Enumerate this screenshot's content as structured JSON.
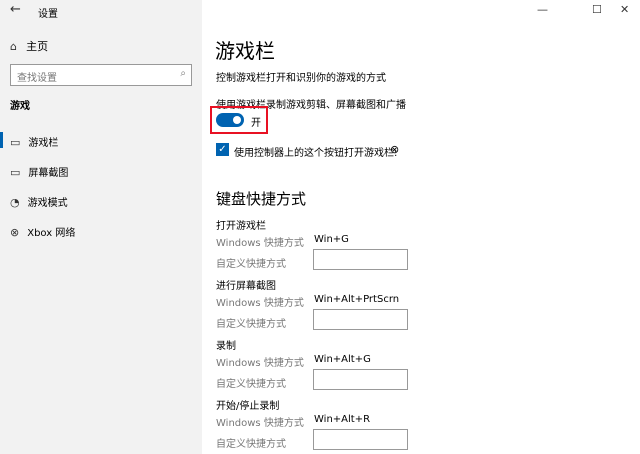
{
  "window": {
    "title": "设置",
    "back_icon": "arrow-left",
    "minimize": "—",
    "maximize": "☐",
    "close": "✕"
  },
  "sidebar": {
    "home": "主页",
    "search_placeholder": "查找设置",
    "section": "游戏",
    "items": [
      {
        "label": "游戏栏",
        "icon": "gamebar-icon"
      },
      {
        "label": "屏幕截图",
        "icon": "screenshot-icon"
      },
      {
        "label": "游戏模式",
        "icon": "gamemode-icon"
      },
      {
        "label": "Xbox 网络",
        "icon": "xbox-icon"
      }
    ]
  },
  "main": {
    "title": "游戏栏",
    "description": "控制游戏栏打开和识别你的游戏的方式",
    "record_label": "使用游戏栏录制游戏剪辑、屏幕截图和广播",
    "toggle_state": "开",
    "checkbox_label": "使用控制器上的这个按钮打开游戏栏:",
    "shortcuts_heading": "键盘快捷方式",
    "windows_label": "Windows 快捷方式",
    "custom_label": "自定义快捷方式",
    "groups": [
      {
        "name": "打开游戏栏",
        "shortcut": "Win+G"
      },
      {
        "name": "进行屏幕截图",
        "shortcut": "Win+Alt+PrtScrn"
      },
      {
        "name": "录制",
        "shortcut": "Win+Alt+G"
      },
      {
        "name": "开始/停止录制",
        "shortcut": "Win+Alt+R"
      }
    ]
  },
  "colors": {
    "accent": "#0063b1",
    "highlight": "#e81123"
  }
}
